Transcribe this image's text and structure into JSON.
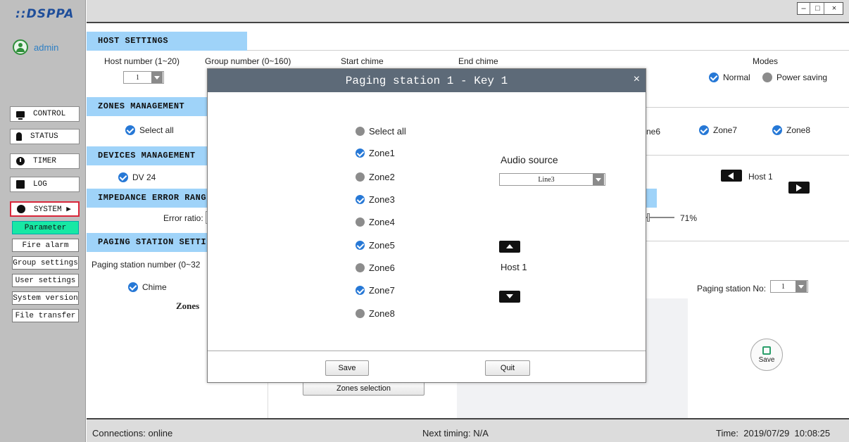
{
  "sidebar": {
    "logo": "::DSPPA",
    "username": "admin",
    "nav": [
      {
        "label": "CONTROL"
      },
      {
        "label": "STATUS"
      },
      {
        "label": "TIMER"
      },
      {
        "label": "LOG"
      },
      {
        "label": "SYSTEM ▶"
      }
    ],
    "submenu": [
      {
        "label": "Parameter"
      },
      {
        "label": "Fire alarm"
      },
      {
        "label": "Group settings"
      },
      {
        "label": "User settings"
      },
      {
        "label": "System version"
      },
      {
        "label": "File transfer"
      }
    ]
  },
  "window_controls": {
    "minimize": "–",
    "maximize": "□",
    "close": "×"
  },
  "host_settings": {
    "title": "HOST SETTINGS",
    "host_number_label": "Host number  (1~20)",
    "host_number_value": "1",
    "group_number_label": "Group number  (0~160)",
    "start_chime_label": "Start chime",
    "end_chime_label": "End chime",
    "modes_label": "Modes",
    "mode_normal": "Normal",
    "mode_power_saving": "Power saving"
  },
  "zones_management": {
    "title": "ZONES MANAGEMENT",
    "select_all": "Select all",
    "zone6_partial": "ne6",
    "zone7": "Zone7",
    "zone8": "Zone8"
  },
  "devices_management": {
    "title": "DEVICES MANAGEMENT",
    "device": "DV 24",
    "host": "Host 1"
  },
  "impedance": {
    "title": "IMPEDANCE ERROR RANG",
    "error_ratio_label": "Error ratio:",
    "slider_value": "71%"
  },
  "paging_station": {
    "title": "PAGING STATION SETTI",
    "number_label": "Paging station number  (0~32",
    "chime": "Chime",
    "zones_label": "Zones",
    "station_no_label": "Paging station No:",
    "station_no_value": "1",
    "zones_selection": "Zones selection",
    "save": "Save"
  },
  "modal": {
    "title": "Paging station 1 - Key 1",
    "close": "×",
    "select_all": "Select all",
    "zones": [
      {
        "label": "Zone1",
        "checked": true
      },
      {
        "label": "Zone2",
        "checked": false
      },
      {
        "label": "Zone3",
        "checked": true
      },
      {
        "label": "Zone4",
        "checked": false
      },
      {
        "label": "Zone5",
        "checked": true
      },
      {
        "label": "Zone6",
        "checked": false
      },
      {
        "label": "Zone7",
        "checked": true
      },
      {
        "label": "Zone8",
        "checked": false
      }
    ],
    "audio_source_label": "Audio source",
    "audio_source_value": "Line3",
    "host_label": "Host 1",
    "save": "Save",
    "quit": "Quit"
  },
  "status_bar": {
    "connections": "Connections: online",
    "next_timing": "Next timing: N/A",
    "time": "Time:  2019/07/29  10:08:25"
  }
}
